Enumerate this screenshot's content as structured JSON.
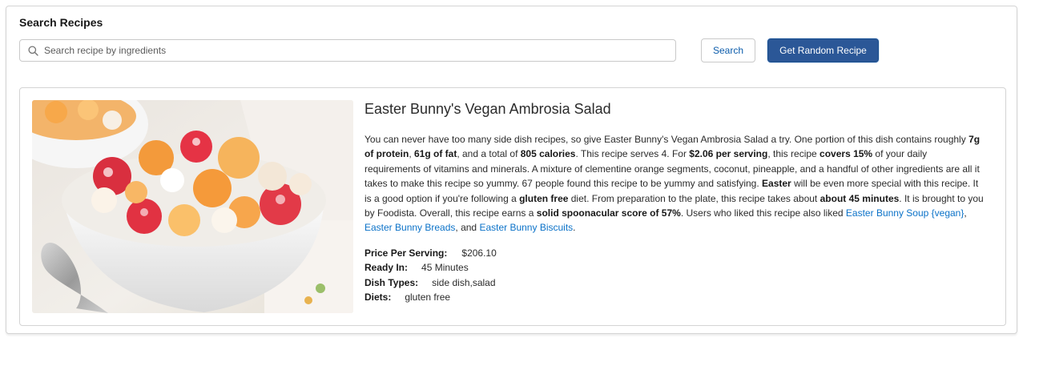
{
  "header": {
    "title": "Search Recipes"
  },
  "search": {
    "placeholder": "Search recipe by ingredients",
    "value": "",
    "search_label": "Search",
    "random_label": "Get Random Recipe"
  },
  "recipe": {
    "title": "Easter Bunny's Vegan Ambrosia Salad",
    "description": [
      {
        "t": "You can never have too many side dish recipes, so give Easter Bunny's Vegan Ambrosia Salad a try. One portion of this dish contains roughly "
      },
      {
        "t": "7g of protein",
        "b": true
      },
      {
        "t": ", "
      },
      {
        "t": "61g of fat",
        "b": true
      },
      {
        "t": ", and a total of "
      },
      {
        "t": "805 calories",
        "b": true
      },
      {
        "t": ". This recipe serves 4. For "
      },
      {
        "t": "$2.06 per serving",
        "b": true
      },
      {
        "t": ", this recipe "
      },
      {
        "t": "covers 15%",
        "b": true
      },
      {
        "t": " of your daily requirements of vitamins and minerals. A mixture of clementine orange segments, coconut, pineapple, and a handful of other ingredients are all it takes to make this recipe so yummy. 67 people found this recipe to be yummy and satisfying. "
      },
      {
        "t": "Easter",
        "b": true
      },
      {
        "t": " will be even more special with this recipe. It is a good option if you're following a "
      },
      {
        "t": "gluten free",
        "b": true
      },
      {
        "t": " diet. From preparation to the plate, this recipe takes about "
      },
      {
        "t": "about 45 minutes",
        "b": true
      },
      {
        "t": ". It is brought to you by Foodista. Overall, this recipe earns a "
      },
      {
        "t": "solid spoonacular score of 57%",
        "b": true
      },
      {
        "t": ". Users who liked this recipe also liked "
      },
      {
        "t": "Easter Bunny Soup {vegan}",
        "link": true
      },
      {
        "t": ", "
      },
      {
        "t": "Easter Bunny Breads",
        "link": true
      },
      {
        "t": ", and "
      },
      {
        "t": "Easter Bunny Biscuits",
        "link": true
      },
      {
        "t": "."
      }
    ],
    "meta": {
      "price_label": "Price Per Serving:",
      "price_value": "$206.10",
      "ready_label": "Ready In:",
      "ready_value": "45 Minutes",
      "dish_label": "Dish Types:",
      "dish_value": "side dish,salad",
      "diets_label": "Diets:",
      "diets_value": "gluten free"
    }
  },
  "colors": {
    "primary_button": "#2b5797",
    "link": "#0b72c8"
  }
}
